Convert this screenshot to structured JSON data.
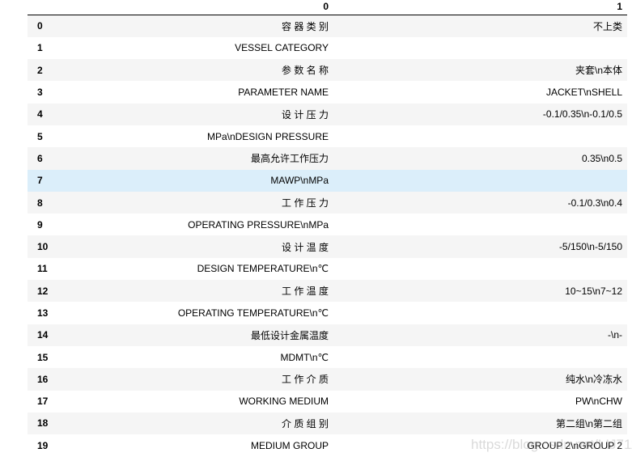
{
  "columns": [
    "",
    "0",
    "1"
  ],
  "rows": [
    {
      "index": "0",
      "c0": "容 器 类 别",
      "c1": "不上类"
    },
    {
      "index": "1",
      "c0": "VESSEL CATEGORY",
      "c1": ""
    },
    {
      "index": "2",
      "c0": "参 数 名 称",
      "c1": "夹套\\n本体"
    },
    {
      "index": "3",
      "c0": "PARAMETER NAME",
      "c1": "JACKET\\nSHELL"
    },
    {
      "index": "4",
      "c0": "设 计 压 力",
      "c1": "-0.1/0.35\\n-0.1/0.5"
    },
    {
      "index": "5",
      "c0": "MPa\\nDESIGN PRESSURE",
      "c1": ""
    },
    {
      "index": "6",
      "c0": "最高允许工作压力",
      "c1": "0.35\\n0.5"
    },
    {
      "index": "7",
      "c0": "MAWP\\nMPa",
      "c1": ""
    },
    {
      "index": "8",
      "c0": "工 作 压 力",
      "c1": "-0.1/0.3\\n0.4"
    },
    {
      "index": "9",
      "c0": "OPERATING PRESSURE\\nMPa",
      "c1": ""
    },
    {
      "index": "10",
      "c0": "设 计 温 度",
      "c1": "-5/150\\n-5/150"
    },
    {
      "index": "11",
      "c0": "DESIGN TEMPERATURE\\n℃",
      "c1": ""
    },
    {
      "index": "12",
      "c0": "工 作 温 度",
      "c1": "10~15\\n7~12"
    },
    {
      "index": "13",
      "c0": "OPERATING TEMPERATURE\\n℃",
      "c1": ""
    },
    {
      "index": "14",
      "c0": "最低设计金属温度",
      "c1": "-\\n-"
    },
    {
      "index": "15",
      "c0": "MDMT\\n℃",
      "c1": ""
    },
    {
      "index": "16",
      "c0": "工 作 介 质",
      "c1": "纯水\\n冷冻水"
    },
    {
      "index": "17",
      "c0": "WORKING MEDIUM",
      "c1": "PW\\nCHW"
    },
    {
      "index": "18",
      "c0": "介 质 组 别",
      "c1": "第二组\\n第二组"
    },
    {
      "index": "19",
      "c0": "MEDIUM GROUP",
      "c1": "GROUP 2\\nGROUP 2"
    }
  ],
  "highlighted_row": "7",
  "watermark": "https://blog.csdn.net/LIJ711"
}
